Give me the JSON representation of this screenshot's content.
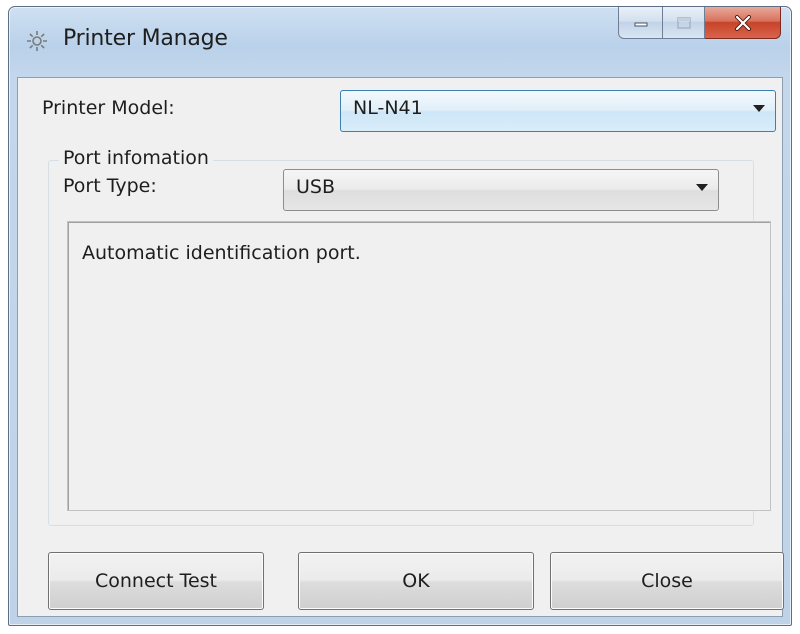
{
  "window": {
    "title": "Printer Manage",
    "icon": "gear-icon"
  },
  "printer_model": {
    "label": "Printer Model:",
    "value": "NL-N41"
  },
  "port_group": {
    "legend": "Port infomation",
    "port_type_label": "Port Type:",
    "port_type_value": "USB",
    "info_text": "Automatic identification port."
  },
  "buttons": {
    "connect_test": "Connect Test",
    "ok": "OK",
    "close": "Close"
  },
  "colors": {
    "frame": "#b9d1ea",
    "close_button": "#c7432a",
    "focus_border": "#3c7fb1"
  }
}
